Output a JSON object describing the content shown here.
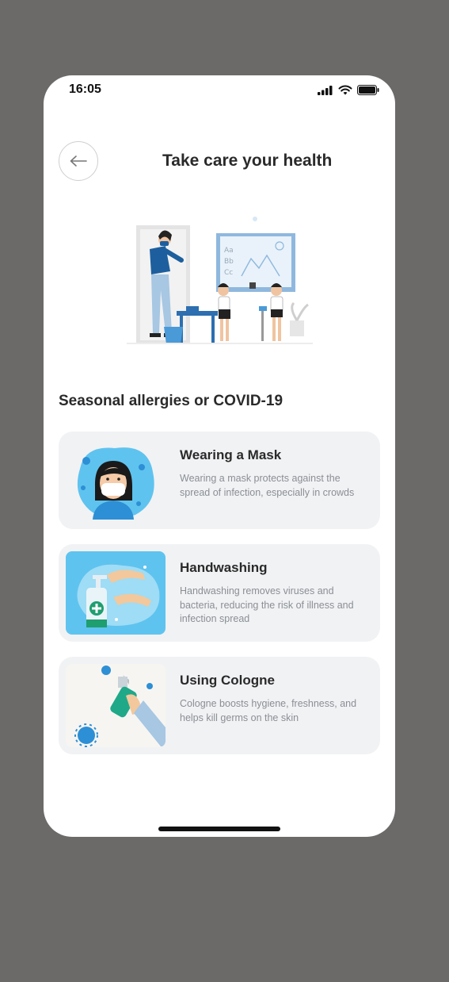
{
  "status_bar": {
    "time": "16:05"
  },
  "header": {
    "title": "Take care your health"
  },
  "section": {
    "title": "Seasonal allergies or COVID-19"
  },
  "cards": [
    {
      "title": "Wearing a Mask",
      "description": "Wearing a mask protects against the spread of infection, especially in crowds"
    },
    {
      "title": "Handwashing",
      "description": "Handwashing removes viruses and bacteria, reducing the risk of illness and infection spread"
    },
    {
      "title": "Using Cologne",
      "description": "Cologne boosts hygiene, freshness, and helps kill germs on the skin"
    }
  ],
  "colors": {
    "background": "#6b6a69",
    "card_background": "#f1f2f4",
    "accent_blue": "#2d8fd5",
    "light_blue": "#5fc3ef",
    "text_dark": "#2a2a2a",
    "text_muted": "#8a8e94"
  }
}
